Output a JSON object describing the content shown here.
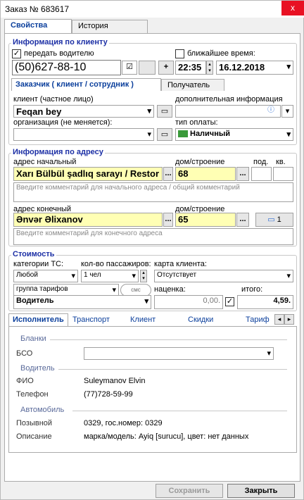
{
  "window": {
    "title": "Заказ № 683617",
    "close_glyph": "x"
  },
  "tabs": [
    "Свойства",
    "История"
  ],
  "client_info": {
    "section": "Информация по клиенту",
    "pass_to_driver": "передать водителю",
    "nearest_time": "ближайшее время:",
    "phone": "(50)627-88-10",
    "time": "22:35",
    "date": "16.12.2018",
    "sub_tabs": [
      "Заказчик ( клиент / сотрудник )",
      "Получатель"
    ],
    "client_label": "клиент (частное лицо)",
    "client_value": "Feqan bey",
    "extra_label": "дополнительная информация",
    "org_label": "организация (не меняется):",
    "pay_label": "тип оплаты:",
    "pay_value": "Наличный"
  },
  "address": {
    "section": "Информация по адресу",
    "start_label": "адрес начальный",
    "start_value": "Xarı Bülbül şadlıq sarayı / Restor",
    "house_label": "дом/строение",
    "start_house": "68",
    "entrance_label": "под.",
    "flat_label": "кв.",
    "start_comment": "Введите комментарий для начального адреса / общий комментарий",
    "end_label": "адрес конечный",
    "end_value": "Ənvər Əlixanov",
    "end_house": "65",
    "stops_count": "1",
    "end_comment": "Введите комментарий для конечного адреса"
  },
  "cost": {
    "section": "Стоимость",
    "category_label": "категории ТС:",
    "category_value": "Любой",
    "passengers_label": "кол-во пассажиров:",
    "passengers_value": "1 чел",
    "card_label": "карта клиента:",
    "card_value": "Отсутствует",
    "tariff_group_label": "группа тарифов",
    "sms_label": "смс",
    "markup_label": "наценка:",
    "total_label": "итого:",
    "tariff_value": "Водитель",
    "markup_value": "0,00.",
    "total_value": "4,59."
  },
  "bottom_tabs": [
    "Исполнитель",
    "Транспорт",
    "Клиент",
    "Скидки",
    "Тариф"
  ],
  "executor": {
    "forms_section": "Бланки",
    "bso_label": "БСО",
    "driver_section": "Водитель",
    "fio_label": "ФИО",
    "fio_value": "Suleymanov Elvin",
    "phone_label": "Телефон",
    "phone_value": "(77)728-59-99",
    "car_section": "Автомобиль",
    "callsign_label": "Позывной",
    "callsign_value": "0329, гос.номер: 0329",
    "desc_label": "Описание",
    "desc_value": "марка/модель: Ayiq [surucu], цвет: нет данных"
  },
  "footer": {
    "save": "Сохранить",
    "close": "Закрыть"
  },
  "glyphs": {
    "check": "☑",
    "checkmark": "✓",
    "ellipsis": "...",
    "plus": "+",
    "arrow_left": "◂",
    "arrow_right": "▸",
    "arrow_up": "▴",
    "arrow_down": "▾",
    "info": "ⓘ",
    "card": "▭"
  },
  "colors": {
    "accent": "#1c2fa5",
    "highlight": "#ffffb4",
    "close": "#e81123"
  }
}
